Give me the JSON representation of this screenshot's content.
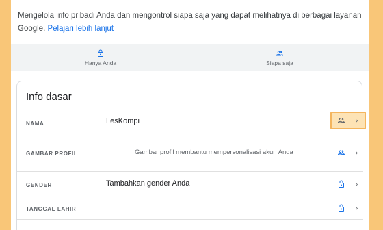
{
  "intro": {
    "text": "Mengelola info pribadi Anda dan mengontrol siapa saja yang dapat melihatnya di berbagai layanan Google. ",
    "link": "Pelajari lebih lanjut"
  },
  "visibility": [
    {
      "label": "Hanya Anda",
      "icon": "lock-icon"
    },
    {
      "label": "Siapa saja",
      "icon": "people-icon"
    }
  ],
  "card": {
    "title": "Info dasar",
    "rows": [
      {
        "key": "NAMA",
        "value": "LesKompi",
        "icon": "people-icon"
      },
      {
        "key": "GAMBAR PROFIL",
        "value": "Gambar profil membantu mempersonalisasi akun Anda",
        "icon": "people-icon"
      },
      {
        "key": "GENDER",
        "value": "Tambahkan gender Anda",
        "icon": "lock-icon"
      },
      {
        "key": "TANGGAL LAHIR",
        "value": "",
        "icon": "lock-icon"
      }
    ]
  },
  "colors": {
    "accent": "#1a73e8",
    "highlight_fill": "#fde3b5",
    "highlight_border": "#f4b55e",
    "page_background": "#f9c678"
  }
}
